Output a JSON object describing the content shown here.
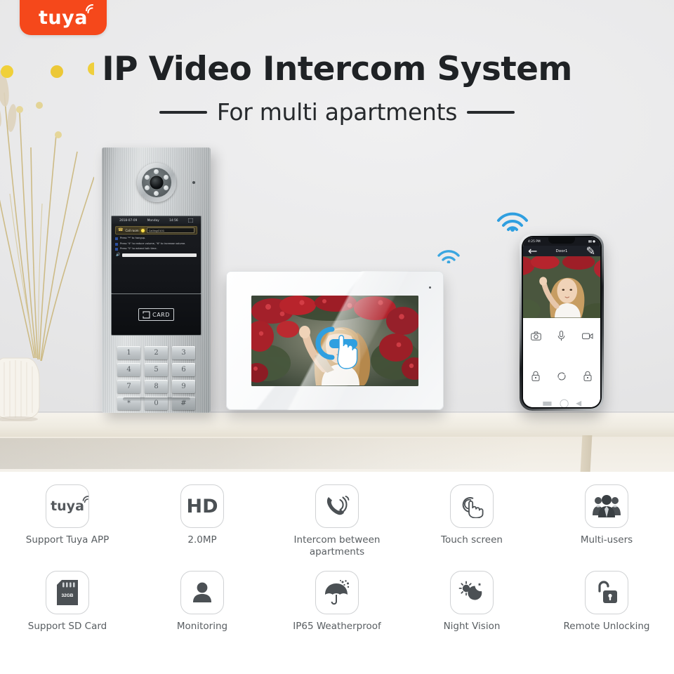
{
  "brand": {
    "badge_text": "tuya",
    "badge_color": "#f5481b"
  },
  "hero": {
    "title": "IP Video Intercom System",
    "subtitle": "For multi apartments"
  },
  "door_station": {
    "screen": {
      "date": "2018-07-09",
      "day": "Monday",
      "time": "14:56",
      "call_label": "Call room",
      "call_value": "Calling0101",
      "tips": [
        "Press \"*\" to hangup.",
        "Press \"4\" to reduce volume, \"6\" to increase volume.",
        "Press \"5\" to extend talk time."
      ]
    },
    "card_reader_label": "CARD",
    "keypad": [
      "1",
      "2",
      "3",
      "4",
      "5",
      "6",
      "7",
      "8",
      "9",
      "*",
      "0",
      "#"
    ]
  },
  "phone_app": {
    "status_time": "4:25 PM",
    "title": "Door1",
    "back_icon": "back-arrow-icon",
    "edit_icon": "edit-pencil-icon",
    "controls": [
      {
        "name": "snapshot",
        "icon": "camera-icon"
      },
      {
        "name": "talk",
        "icon": "microphone-icon"
      },
      {
        "name": "record",
        "icon": "video-camera-icon"
      },
      {
        "name": "lock1",
        "icon": "lock-icon"
      },
      {
        "name": "switch",
        "icon": "refresh-loop-icon"
      },
      {
        "name": "lock2",
        "icon": "lock-icon"
      }
    ]
  },
  "wifi": {
    "accent": "#37a5dc"
  },
  "features": [
    {
      "label": "Support Tuya APP",
      "icon": "tuya-logo-icon"
    },
    {
      "label": "2.0MP",
      "icon": "hd-icon",
      "icon_text": "HD"
    },
    {
      "label": "Intercom between apartments",
      "icon": "phone-waves-icon"
    },
    {
      "label": "Touch screen",
      "icon": "touch-hand-icon"
    },
    {
      "label": "Multi-users",
      "icon": "multi-users-icon"
    },
    {
      "label": "Support SD Card",
      "icon": "sd-card-icon",
      "icon_text": "32GB"
    },
    {
      "label": "Monitoring",
      "icon": "person-icon"
    },
    {
      "label": "IP65 Weatherproof",
      "icon": "umbrella-icon"
    },
    {
      "label": "Night Vision",
      "icon": "sun-moon-icon"
    },
    {
      "label": "Remote Unlocking",
      "icon": "unlock-icon"
    }
  ]
}
